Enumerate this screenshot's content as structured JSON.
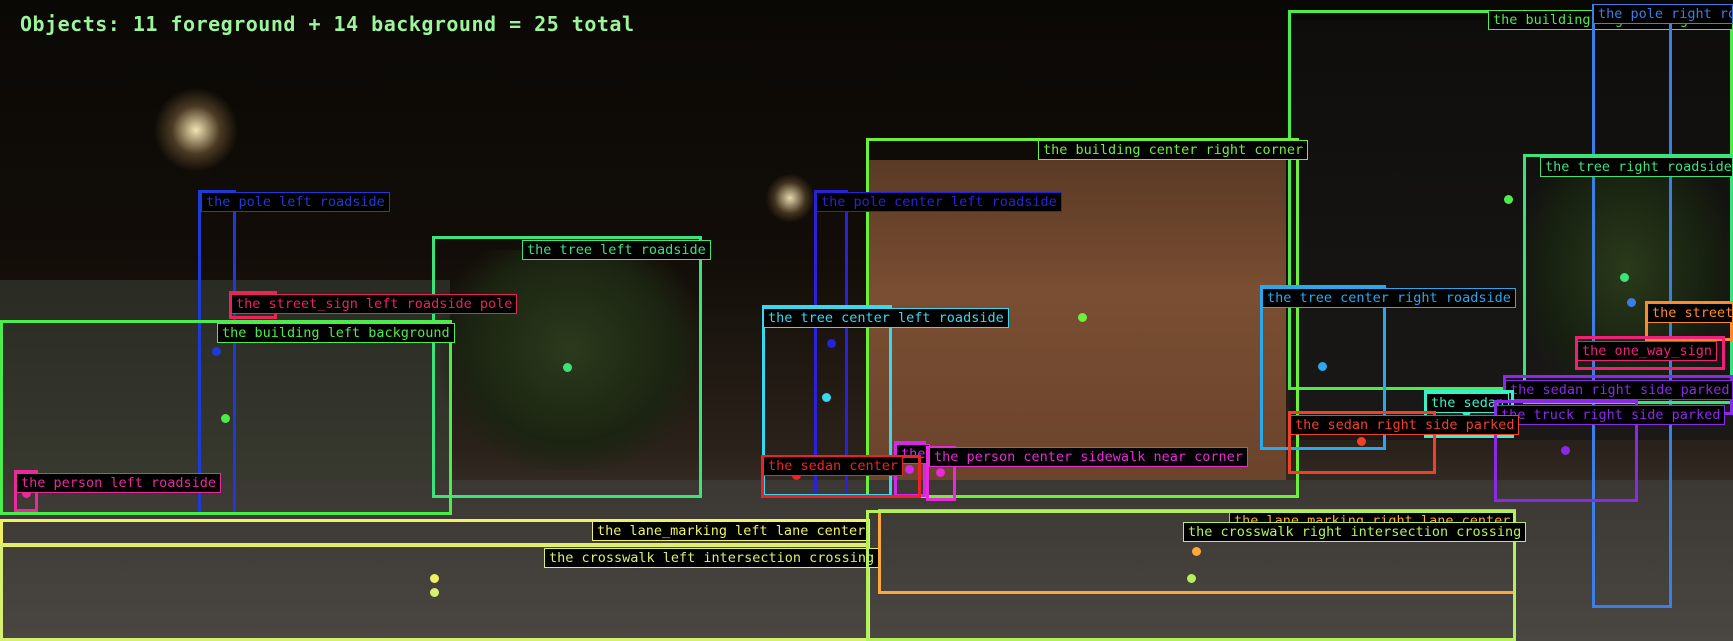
{
  "header": {
    "summary": "Objects: 11 foreground + 14 background = 25 total"
  },
  "detections": [
    {
      "id": "building-right-background",
      "label": "the building right background",
      "color": "#4cec4c"
    },
    {
      "id": "pole-right",
      "label": "the pole right ro",
      "color": "#3a7ee6"
    },
    {
      "id": "building-center-right-corner",
      "label": "the building center right corner",
      "color": "#6cf03a"
    },
    {
      "id": "tree-right-roadside",
      "label": "the tree right roadside",
      "color": "#3ae47a"
    },
    {
      "id": "pole-left-roadside",
      "label": "the pole left roadside",
      "color": "#1e3ad8"
    },
    {
      "id": "pole-center-left-roadside",
      "label": "the pole center left roadside",
      "color": "#2a22d8"
    },
    {
      "id": "tree-left-roadside",
      "label": "the tree left roadside",
      "color": "#3ae47a"
    },
    {
      "id": "street-sign-left",
      "label": "the street_sign left roadside pole",
      "color": "#e8245a"
    },
    {
      "id": "tree-center-right-roadside",
      "label": "the tree center right roadside",
      "color": "#2aa8ee"
    },
    {
      "id": "street-right",
      "label": "the street",
      "color": "#ff8a2a"
    },
    {
      "id": "building-left-background",
      "label": "the building left background",
      "color": "#4cec4c"
    },
    {
      "id": "tree-center-left-roadside",
      "label": "the tree center left roadside",
      "color": "#38d8ee"
    },
    {
      "id": "one-way-sign",
      "label": "the one_way_sign",
      "color": "#f0207a"
    },
    {
      "id": "sedan-right-side-parked-2",
      "label": "the sedan right side parked",
      "color": "#8a2ae8"
    },
    {
      "id": "sedan-small",
      "label": "the sedan",
      "color": "#3af0c8"
    },
    {
      "id": "truck-right-side-parked",
      "label": "the truck right side parked",
      "color": "#8a2ae8"
    },
    {
      "id": "sedan-right-side-parked",
      "label": "the sedan right side parked",
      "color": "#f0402a"
    },
    {
      "id": "person-center-left",
      "label": "the",
      "color": "#d42ae8"
    },
    {
      "id": "person-center-sidewalk",
      "label": "the person center sidewalk near corner",
      "color": "#e82ad8"
    },
    {
      "id": "sedan-center",
      "label": "the sedan center",
      "color": "#ee2222"
    },
    {
      "id": "person-left-roadside",
      "label": "the person left roadside",
      "color": "#e82a9a"
    },
    {
      "id": "lane-marking-left",
      "label": "the lane_marking left lane center",
      "color": "#f0f060"
    },
    {
      "id": "crosswalk-left",
      "label": "the crosswalk left intersection crossing",
      "color": "#d8f070"
    },
    {
      "id": "lane-marking-right",
      "label": "the lane_marking right lane center",
      "color": "#ffa83a"
    },
    {
      "id": "crosswalk-right",
      "label": "the crosswalk right intersection crossing",
      "color": "#b4f05a"
    }
  ]
}
